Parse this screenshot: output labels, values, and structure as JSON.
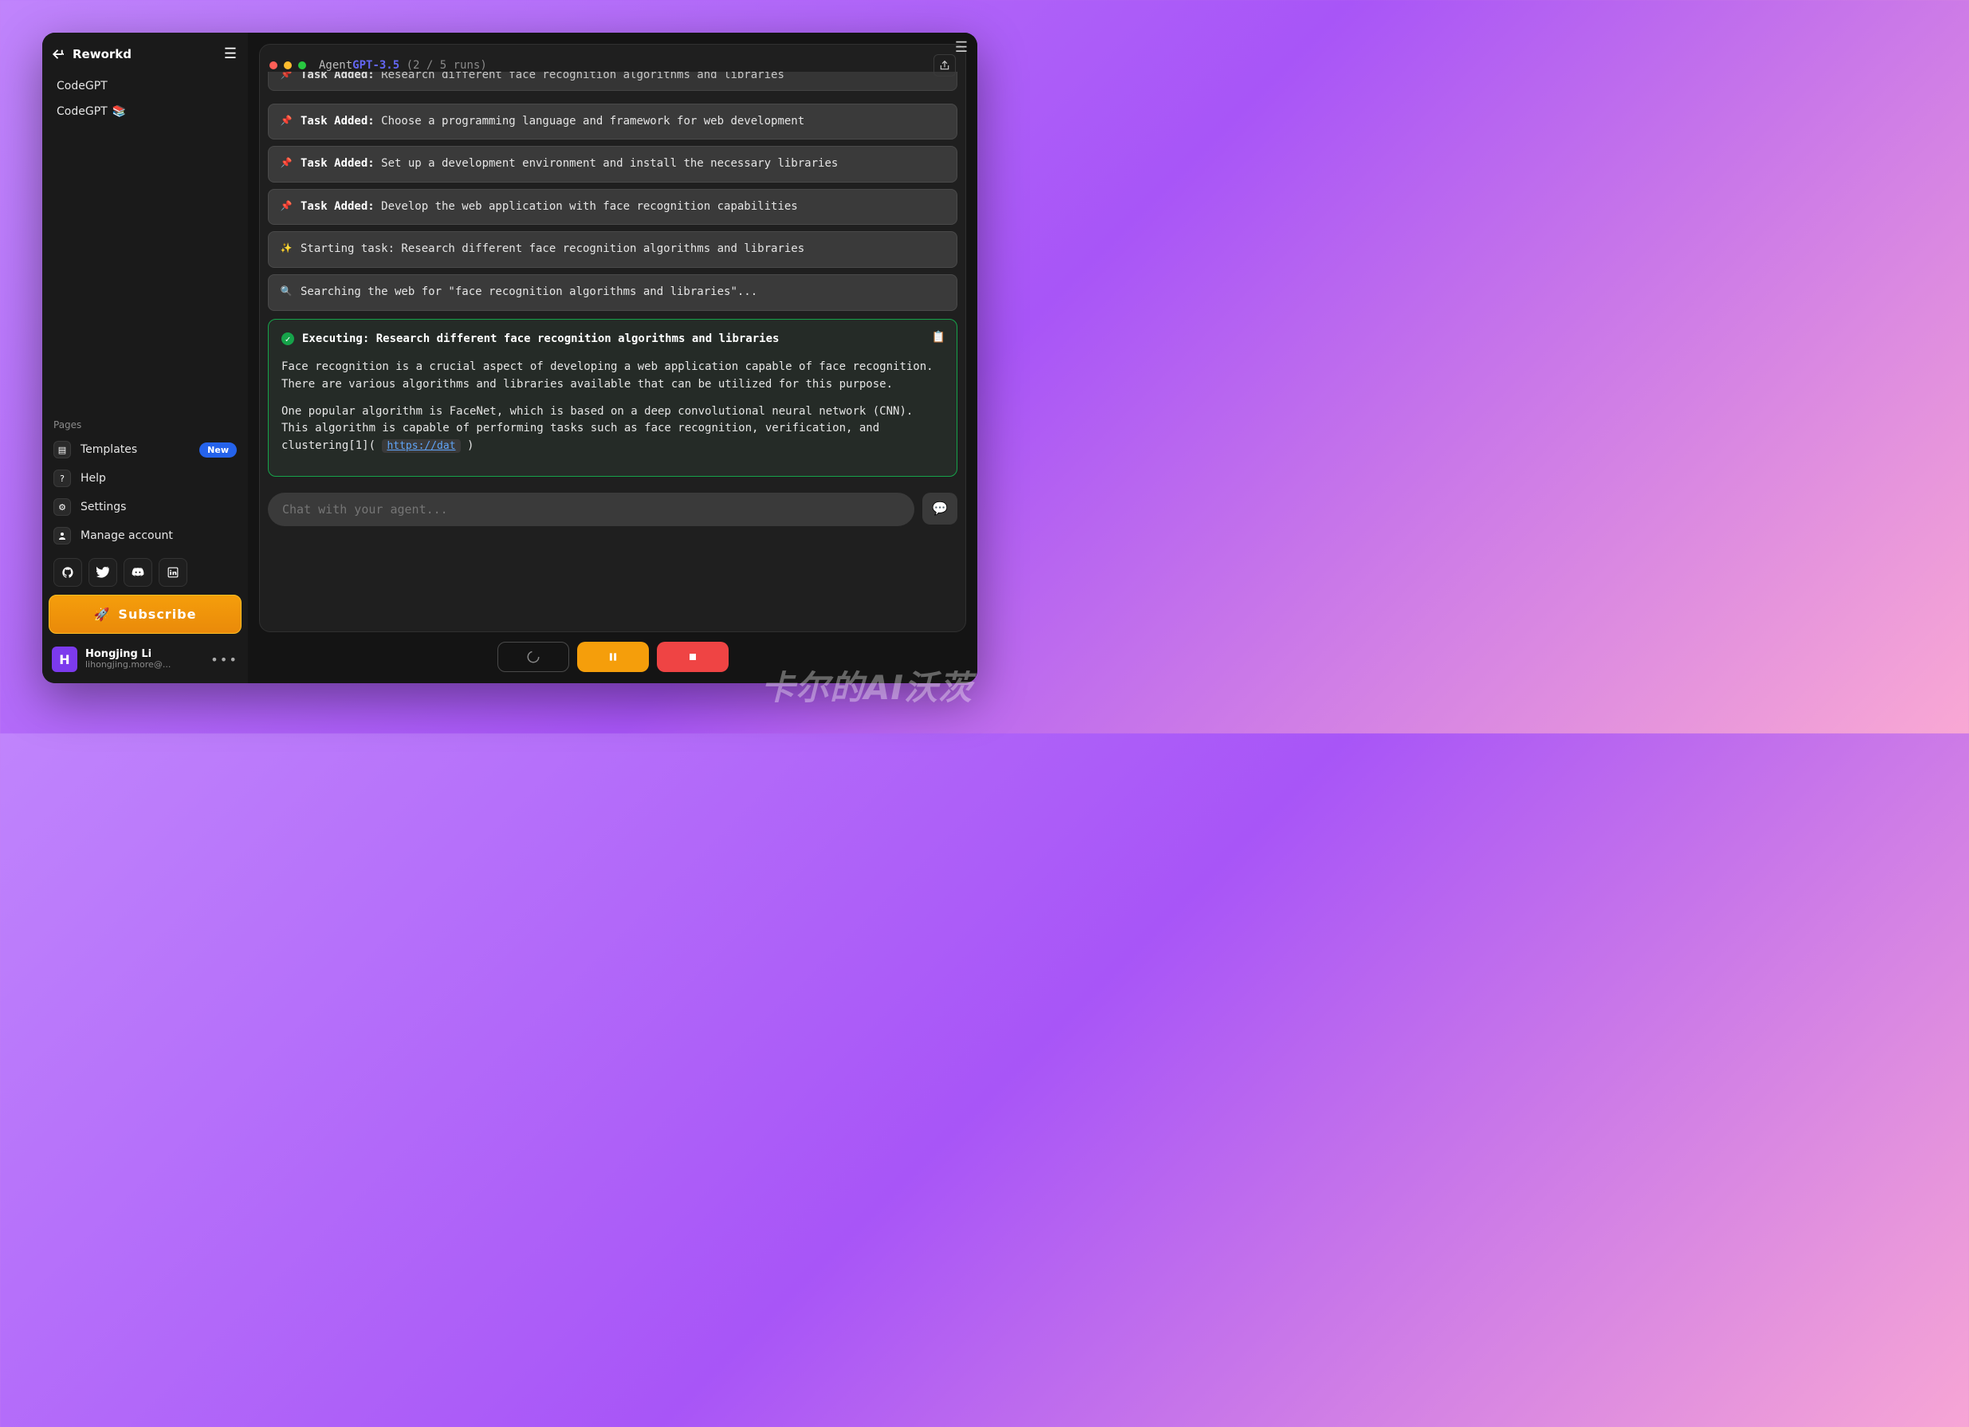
{
  "brand": "Reworkd",
  "sidebar": {
    "items": [
      {
        "label": "CodeGPT",
        "emoji": ""
      },
      {
        "label": "CodeGPT",
        "emoji": "📚"
      }
    ],
    "pages_label": "Pages",
    "pages": [
      {
        "label": "Templates",
        "badge": "New",
        "icon": "▢"
      },
      {
        "label": "Help",
        "icon": "?"
      },
      {
        "label": "Settings",
        "icon": "⚙"
      },
      {
        "label": "Manage account",
        "icon": "👤"
      }
    ],
    "subscribe_label": "Subscribe"
  },
  "user": {
    "initial": "H",
    "name": "Hongjing Li",
    "email": "lihongjing.more@..."
  },
  "console": {
    "title_agent": "Agent",
    "title_gpt": "GPT-3.5",
    "runs": "(2 / 5 runs)",
    "tasks": [
      {
        "type": "added",
        "label": "Task Added:",
        "text": "Research different face recognition algorithms and libraries",
        "clipped": true
      },
      {
        "type": "added",
        "label": "Task Added:",
        "text": "Choose a programming language and framework for web development"
      },
      {
        "type": "added",
        "label": "Task Added:",
        "text": "Set up a development environment and install the necessary libraries"
      },
      {
        "type": "added",
        "label": "Task Added:",
        "text": "Develop the web application with face recognition capabilities"
      },
      {
        "type": "starting",
        "icon": "✨",
        "text": "Starting task: Research different face recognition algorithms and libraries"
      },
      {
        "type": "searching",
        "icon": "🔍",
        "text": "Searching the web for \"face recognition algorithms and libraries\"..."
      }
    ],
    "executing": {
      "title": "Executing: Research different face recognition algorithms and libraries",
      "p1": "Face recognition is a crucial aspect of developing a web application capable of face recognition. There are various algorithms and libraries available that can be utilized for this purpose.",
      "p2_pre": "One popular algorithm is FaceNet, which is based on a deep convolutional neural network (CNN). This algorithm is capable of performing tasks such as face recognition, verification, and clustering[1]( ",
      "link": "https://dat"
    },
    "chat_placeholder": "Chat with your agent..."
  },
  "watermark": "卡尔的AI沃茨"
}
